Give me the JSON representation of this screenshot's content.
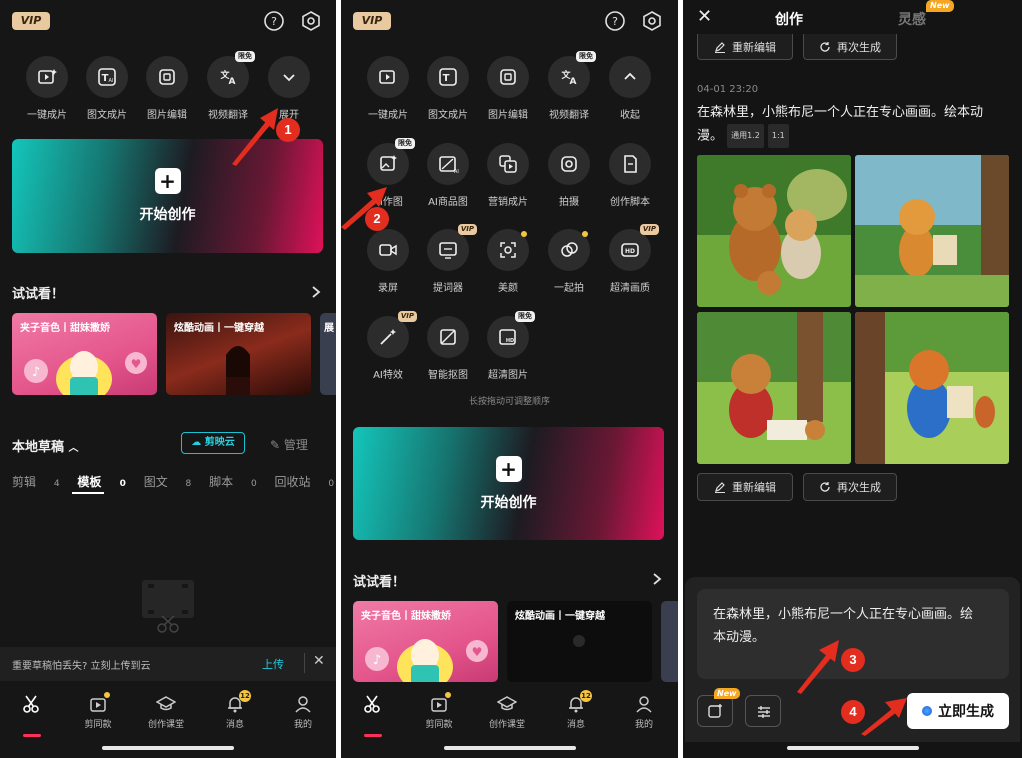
{
  "panel1": {
    "vip": "VIP",
    "tools": [
      {
        "label": "一键成片"
      },
      {
        "label": "图文成片"
      },
      {
        "label": "图片编辑"
      },
      {
        "label": "视频翻译",
        "badge": "限免"
      },
      {
        "label": "展开"
      }
    ],
    "start_label": "开始创作",
    "try_title": "试试看！",
    "templates": [
      {
        "title": "夹子音色丨甜妹撒娇"
      },
      {
        "title": "炫酷动画丨一键穿越"
      },
      {
        "title": "展"
      }
    ],
    "drafts_title": "本地草稿",
    "cloud_label": "剪映云",
    "manage_label": "管理",
    "tabs": [
      {
        "label": "剪辑",
        "count": "4"
      },
      {
        "label": "模板",
        "count": "0"
      },
      {
        "label": "图文",
        "count": "8"
      },
      {
        "label": "脚本",
        "count": "0"
      },
      {
        "label": "回收站",
        "count": "0"
      }
    ],
    "upload_prompt": "重要草稿怕丢失? 立刻上传到云",
    "upload_label": "上传"
  },
  "panel2": {
    "tools": [
      {
        "label": "一键成片"
      },
      {
        "label": "图文成片"
      },
      {
        "label": "图片编辑"
      },
      {
        "label": "视频翻译",
        "badge": "限免"
      },
      {
        "label": "收起"
      },
      {
        "label": "AI作图",
        "badge": "限免"
      },
      {
        "label": "AI商品图"
      },
      {
        "label": "营销成片"
      },
      {
        "label": "拍摄"
      },
      {
        "label": "创作脚本"
      },
      {
        "label": "录屏"
      },
      {
        "label": "提词器",
        "badge": "VIP"
      },
      {
        "label": "美颜"
      },
      {
        "label": "一起拍"
      },
      {
        "label": "超清画质",
        "badge": "VIP"
      },
      {
        "label": "AI特效",
        "badge": "VIP"
      },
      {
        "label": "智能抠图"
      },
      {
        "label": "超清图片",
        "badge": "限免"
      }
    ],
    "drag_hint": "长按拖动可调整顺序",
    "start_label": "开始创作",
    "try_title": "试试看！",
    "templates": [
      {
        "title": "夹子音色丨甜妹撒娇"
      },
      {
        "title": "炫酷动画丨一键穿越"
      }
    ]
  },
  "bottom_nav": [
    {
      "label": ""
    },
    {
      "label": "剪同款"
    },
    {
      "label": "创作课堂"
    },
    {
      "label": "消息",
      "badge": "12"
    },
    {
      "label": "我的"
    }
  ],
  "panel3": {
    "tab_create": "创作",
    "tab_inspire": "灵感",
    "new_badge": "New",
    "reedit": "重新编辑",
    "regenerate": "再次生成",
    "timestamp": "04-01 23:20",
    "prompt_text": "在森林里，小熊布尼一个人正在专心画画。绘本动漫。",
    "tags": [
      "通用1.2",
      "1:1"
    ],
    "input_text": "在森林里，小熊布尼一个人正在专心画画。绘本动漫。",
    "generate": "立即生成"
  },
  "steps": [
    "1",
    "2",
    "3",
    "4"
  ]
}
